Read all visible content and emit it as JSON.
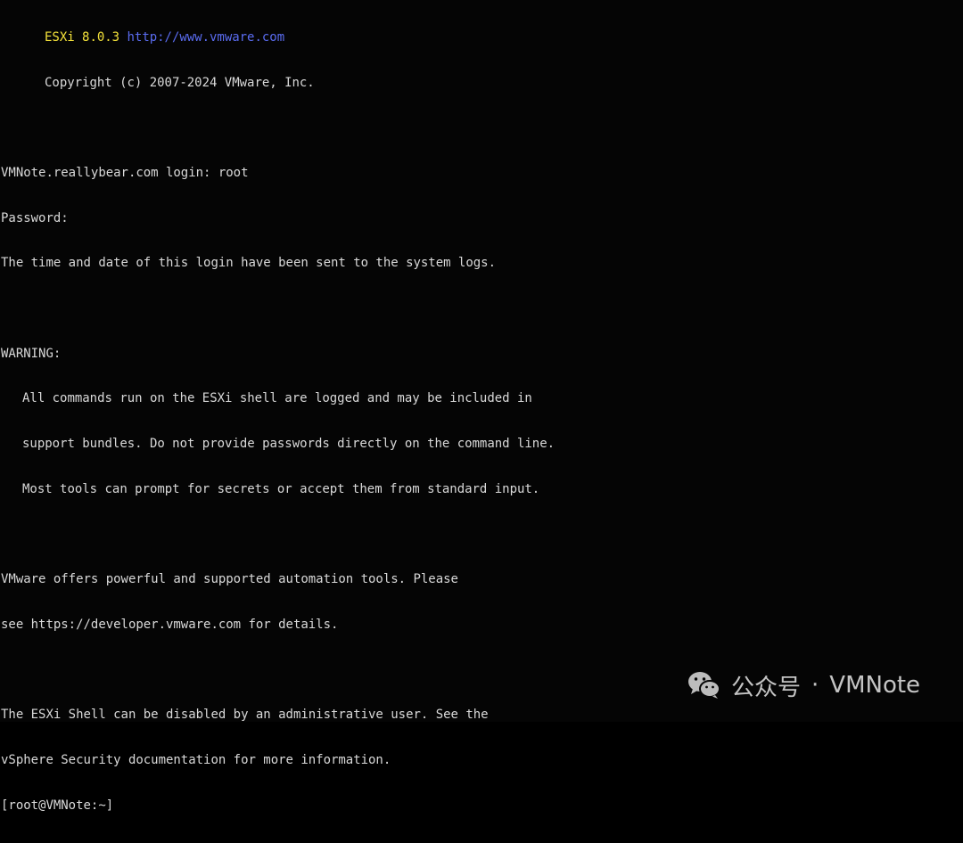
{
  "terminal": {
    "banner_product": "ESXi 8.0.3",
    "banner_url": "http://www.vmware.com",
    "banner_copyright": "Copyright (c) 2007-2024 VMware, Inc.",
    "login_prompt": "VMNote.reallybear.com login: root",
    "password_prompt": "Password:",
    "login_notice": "The time and date of this login have been sent to the system logs.",
    "warning_title": "WARNING:",
    "warning_lines": [
      "All commands run on the ESXi shell are logged and may be included in",
      "support bundles. Do not provide passwords directly on the command line.",
      "Most tools can prompt for secrets or accept them from standard input."
    ],
    "automation_lines": [
      "VMware offers powerful and supported automation tools. Please",
      "see https://developer.vmware.com for details."
    ],
    "shell_lines": [
      "The ESXi Shell can be disabled by an administrative user. See the",
      "vSphere Security documentation for more information."
    ],
    "shell_prompt": "[root@VMNote:~]"
  },
  "watermark": {
    "logo_icon": "wechat-icon",
    "label": "公众号",
    "separator": "·",
    "account": "VMNote"
  },
  "colors": {
    "background": "#050505",
    "text": "#d9d9d9",
    "product_highlight": "#f4e23a",
    "url_highlight": "#5a6cf0"
  }
}
